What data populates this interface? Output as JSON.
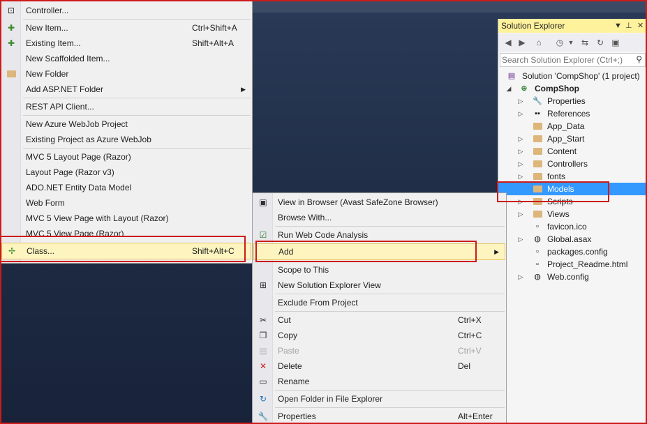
{
  "left_menu": {
    "items": [
      {
        "label": "Controller...",
        "shortcut": "",
        "icon": "controller-icon"
      },
      {
        "label": "New Item...",
        "shortcut": "Ctrl+Shift+A",
        "icon": "new-item-icon"
      },
      {
        "label": "Existing Item...",
        "shortcut": "Shift+Alt+A",
        "icon": "existing-item-icon"
      },
      {
        "label": "New Scaffolded Item...",
        "shortcut": "",
        "icon": ""
      },
      {
        "label": "New Folder",
        "shortcut": "",
        "icon": "new-folder-icon"
      },
      {
        "label": "Add ASP.NET Folder",
        "shortcut": "",
        "icon": ""
      },
      {
        "label": "REST API Client...",
        "shortcut": "",
        "icon": ""
      },
      {
        "label": "New Azure WebJob Project",
        "shortcut": "",
        "icon": ""
      },
      {
        "label": "Existing Project as Azure WebJob",
        "shortcut": "",
        "icon": ""
      },
      {
        "label": "MVC 5 Layout Page (Razor)",
        "shortcut": "",
        "icon": ""
      },
      {
        "label": "Layout Page (Razor v3)",
        "shortcut": "",
        "icon": ""
      },
      {
        "label": "ADO.NET Entity Data Model",
        "shortcut": "",
        "icon": ""
      },
      {
        "label": "Web Form",
        "shortcut": "",
        "icon": ""
      },
      {
        "label": "MVC 5 View Page with Layout (Razor)",
        "shortcut": "",
        "icon": ""
      },
      {
        "label": "MVC 5 View Page (Razor)",
        "shortcut": "",
        "icon": ""
      },
      {
        "label": "Class...",
        "shortcut": "Shift+Alt+C",
        "icon": "class-icon"
      }
    ]
  },
  "context_menu": {
    "items": [
      {
        "label": "View in Browser (Avast SafeZone Browser)",
        "shortcut": ""
      },
      {
        "label": "Browse With...",
        "shortcut": ""
      },
      {
        "label": "Run Web Code Analysis",
        "shortcut": ""
      },
      {
        "label": "Add",
        "shortcut": ""
      },
      {
        "label": "Scope to This",
        "shortcut": ""
      },
      {
        "label": "New Solution Explorer View",
        "shortcut": ""
      },
      {
        "label": "Exclude From Project",
        "shortcut": ""
      },
      {
        "label": "Cut",
        "shortcut": "Ctrl+X"
      },
      {
        "label": "Copy",
        "shortcut": "Ctrl+C"
      },
      {
        "label": "Paste",
        "shortcut": "Ctrl+V"
      },
      {
        "label": "Delete",
        "shortcut": "Del"
      },
      {
        "label": "Rename",
        "shortcut": ""
      },
      {
        "label": "Open Folder in File Explorer",
        "shortcut": ""
      },
      {
        "label": "Properties",
        "shortcut": "Alt+Enter"
      }
    ]
  },
  "solution_explorer": {
    "title": "Solution Explorer",
    "search_placeholder": "Search Solution Explorer (Ctrl+;)",
    "tree": [
      {
        "label": "Solution 'CompShop' (1 project)"
      },
      {
        "label": "CompShop"
      },
      {
        "label": "Properties"
      },
      {
        "label": "References"
      },
      {
        "label": "App_Data"
      },
      {
        "label": "App_Start"
      },
      {
        "label": "Content"
      },
      {
        "label": "Controllers"
      },
      {
        "label": "fonts"
      },
      {
        "label": "Models"
      },
      {
        "label": "Scripts"
      },
      {
        "label": "Views"
      },
      {
        "label": "favicon.ico"
      },
      {
        "label": "Global.asax"
      },
      {
        "label": "packages.config"
      },
      {
        "label": "Project_Readme.html"
      },
      {
        "label": "Web.config"
      }
    ]
  },
  "colors": {
    "highlight": "#fdf4bf",
    "selection": "#3399ff",
    "annotation_red": "#cc1b1b",
    "title_yellow": "#fff29d"
  }
}
